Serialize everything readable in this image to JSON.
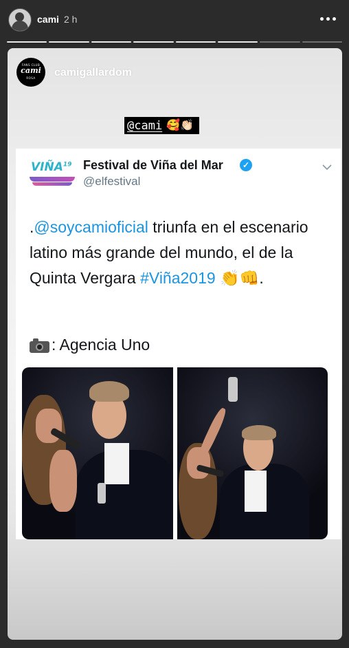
{
  "header": {
    "username": "cami",
    "time_ago": "2 h"
  },
  "progress": {
    "total": 8,
    "active": 6
  },
  "story": {
    "poster_username": "camigallardom",
    "avatar_logo": {
      "top": "FANS CLUB",
      "main": "cami",
      "bottom": "ROSA"
    },
    "mention_sticker": {
      "text": "@cami",
      "emojis": "🥰👏🏻"
    }
  },
  "tweet": {
    "logo_text": "VIÑA",
    "logo_number": "19",
    "display_name": "Festival de Viña del Mar",
    "handle": "@elfestival",
    "body": {
      "prefix": ".",
      "mention": "@soycamioficial",
      "text": " triunfa en el escenario latino más grande del mundo, el de la Quinta Vergara ",
      "hashtag": "#Viña2019",
      "emojis": " 👏👊."
    },
    "credit": ": Agencia Uno"
  },
  "colors": {
    "background": "#2b2b2b",
    "link_blue": "#1b95e0",
    "verified_blue": "#1da1f2"
  }
}
